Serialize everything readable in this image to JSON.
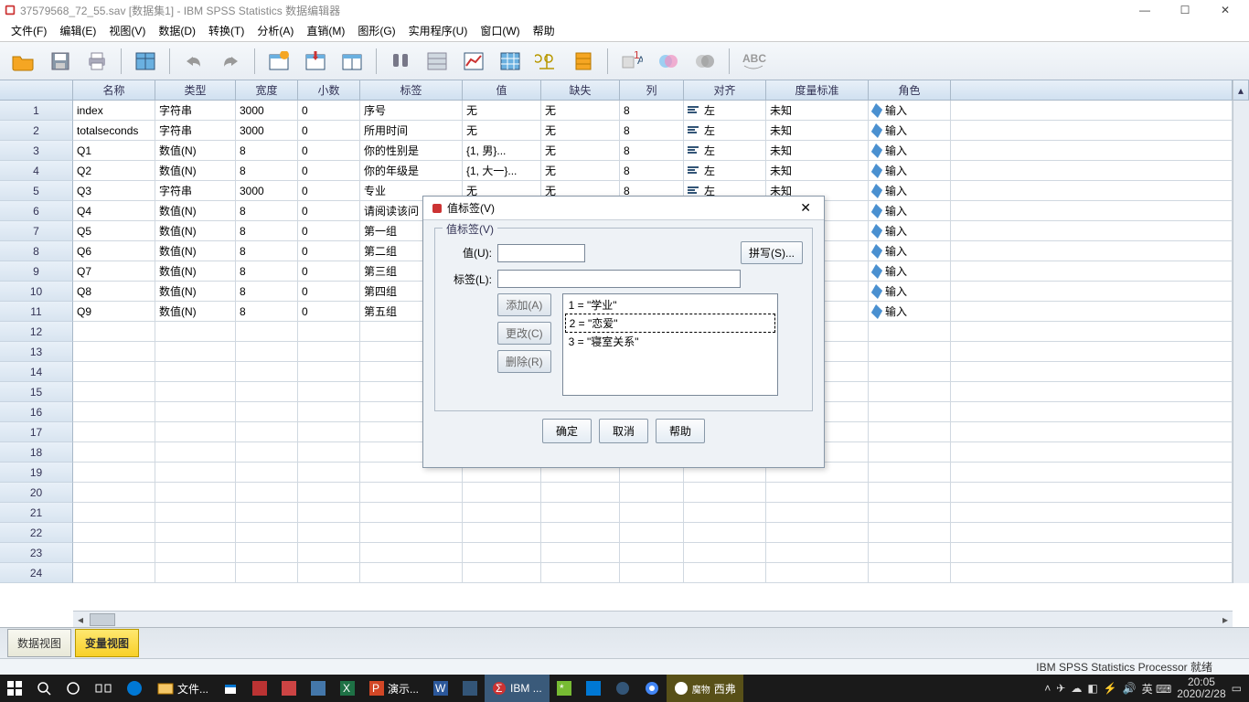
{
  "window": {
    "title": "37579568_72_55.sav [数据集1] - IBM SPSS Statistics 数据编辑器",
    "min": "—",
    "max": "☐",
    "close": "✕"
  },
  "menus": [
    "文件(F)",
    "编辑(E)",
    "视图(V)",
    "数据(D)",
    "转换(T)",
    "分析(A)",
    "直销(M)",
    "图形(G)",
    "实用程序(U)",
    "窗口(W)",
    "帮助"
  ],
  "columns": [
    "名称",
    "类型",
    "宽度",
    "小数",
    "标签",
    "值",
    "缺失",
    "列",
    "对齐",
    "度量标准",
    "角色"
  ],
  "rows": [
    {
      "n": "1",
      "name": "index",
      "type": "字符串",
      "width": "3000",
      "dec": "0",
      "label": "序号",
      "value": "无",
      "missing": "无",
      "cols": "8",
      "align": "左",
      "measure": "未知",
      "role": "输入"
    },
    {
      "n": "2",
      "name": "totalseconds",
      "type": "字符串",
      "width": "3000",
      "dec": "0",
      "label": "所用时间",
      "value": "无",
      "missing": "无",
      "cols": "8",
      "align": "左",
      "measure": "未知",
      "role": "输入"
    },
    {
      "n": "3",
      "name": "Q1",
      "type": "数值(N)",
      "width": "8",
      "dec": "0",
      "label": "你的性别是",
      "value": "{1, 男}...",
      "missing": "无",
      "cols": "8",
      "align": "左",
      "measure": "未知",
      "role": "输入"
    },
    {
      "n": "4",
      "name": "Q2",
      "type": "数值(N)",
      "width": "8",
      "dec": "0",
      "label": "你的年级是",
      "value": "{1, 大一}...",
      "missing": "无",
      "cols": "8",
      "align": "左",
      "measure": "未知",
      "role": "输入"
    },
    {
      "n": "5",
      "name": "Q3",
      "type": "字符串",
      "width": "3000",
      "dec": "0",
      "label": "专业",
      "value": "无",
      "missing": "无",
      "cols": "8",
      "align": "左",
      "measure": "未知",
      "role": "输入"
    },
    {
      "n": "6",
      "name": "Q4",
      "type": "数值(N)",
      "width": "8",
      "dec": "0",
      "label": "请阅读该问",
      "value": "",
      "missing": "",
      "cols": "",
      "align": "",
      "measure": "",
      "role": "输入"
    },
    {
      "n": "7",
      "name": "Q5",
      "type": "数值(N)",
      "width": "8",
      "dec": "0",
      "label": "第一组",
      "value": "",
      "missing": "",
      "cols": "",
      "align": "",
      "measure": "",
      "role": "输入"
    },
    {
      "n": "8",
      "name": "Q6",
      "type": "数值(N)",
      "width": "8",
      "dec": "0",
      "label": "第二组",
      "value": "",
      "missing": "",
      "cols": "",
      "align": "",
      "measure": "",
      "role": "输入"
    },
    {
      "n": "9",
      "name": "Q7",
      "type": "数值(N)",
      "width": "8",
      "dec": "0",
      "label": "第三组",
      "value": "",
      "missing": "",
      "cols": "",
      "align": "",
      "measure": "",
      "role": "输入"
    },
    {
      "n": "10",
      "name": "Q8",
      "type": "数值(N)",
      "width": "8",
      "dec": "0",
      "label": "第四组",
      "value": "",
      "missing": "",
      "cols": "",
      "align": "",
      "measure": "",
      "role": "输入"
    },
    {
      "n": "11",
      "name": "Q9",
      "type": "数值(N)",
      "width": "8",
      "dec": "0",
      "label": "第五组",
      "value": "",
      "missing": "",
      "cols": "",
      "align": "",
      "measure": "",
      "role": "输入"
    }
  ],
  "empty_rows": [
    "12",
    "13",
    "14",
    "15",
    "16",
    "17",
    "18",
    "19",
    "20",
    "21",
    "22",
    "23",
    "24"
  ],
  "tabs": {
    "data_view": "数据视图",
    "variable_view": "变量视图"
  },
  "status": "IBM SPSS Statistics Processor 就绪",
  "dialog": {
    "title": "值标签(V)",
    "group": "值标签(V)",
    "value_label": "值(U):",
    "label_label": "标签(L):",
    "spelling": "拼写(S)...",
    "add": "添加(A)",
    "change": "更改(C)",
    "remove": "删除(R)",
    "items": [
      "1 = \"学业\"",
      "2 = \"恋爱\"",
      "3 = \"寝室关系\""
    ],
    "selected_index": 1,
    "ok": "确定",
    "cancel": "取消",
    "help": "帮助"
  },
  "taskbar": {
    "items": [
      "文件...",
      "演示...",
      "IBM ...",
      "西弗"
    ],
    "mowu": "魔物",
    "time": "20:05",
    "date": "2020/2/28",
    "ime": "英 ⌨"
  }
}
